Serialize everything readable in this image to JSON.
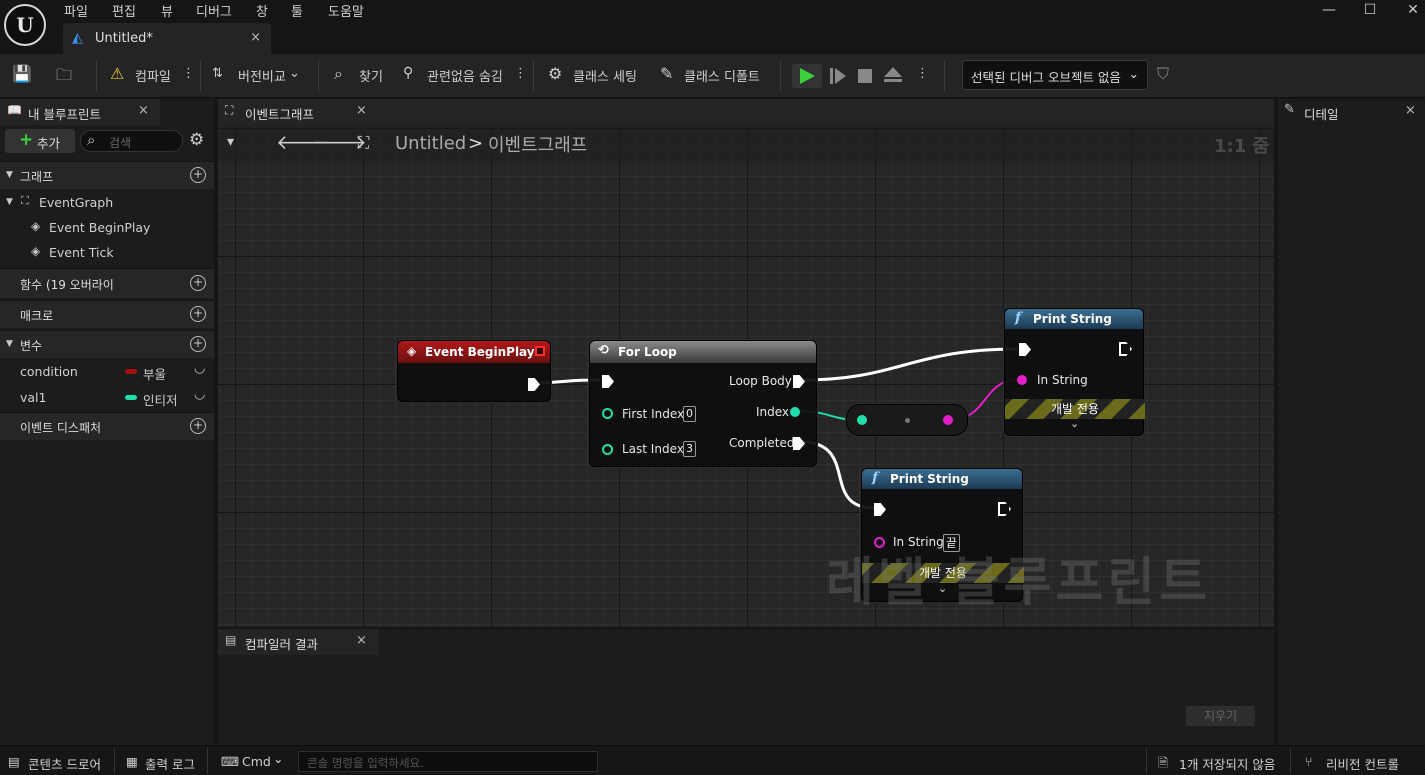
{
  "menu": [
    "파일",
    "편집",
    "뷰",
    "디버그",
    "창",
    "툴",
    "도움말"
  ],
  "doc_tab": {
    "label": "Untitled*",
    "close": "×"
  },
  "window": {
    "minimize": "—",
    "maximize": "☐",
    "close": "✕"
  },
  "toolbar": {
    "compile": "컴파일",
    "diff": "버전비교",
    "find": "찾기",
    "hide_unrelated": "관련없음 숨김",
    "class_settings": "클래스 세팅",
    "class_defaults": "클래스 디폴트",
    "debug_object": "선택된 디버그 오브젝트 없음"
  },
  "my_blueprint": {
    "tab": "내 블루프린트",
    "add": "추가",
    "search_placeholder": "검색",
    "graphs_header": "그래프",
    "event_graph": "EventGraph",
    "events": [
      "Event BeginPlay",
      "Event Tick"
    ],
    "functions_header": "함수 (19 오버라이",
    "macros_header": "매크로",
    "variables_header": "변수",
    "variables": [
      {
        "name": "condition",
        "type": "부울",
        "color": "#a40e0e"
      },
      {
        "name": "val1",
        "type": "인티저",
        "color": "#1fe0ac"
      }
    ],
    "dispatchers_header": "이벤트 디스패처"
  },
  "graph": {
    "tab": "이벤트그래프",
    "breadcrumb_root": "Untitled",
    "breadcrumb_sep": ">",
    "breadcrumb_current": "이벤트그래프",
    "zoom": "1:1 줌",
    "watermark": "레벨 블루프린트"
  },
  "nodes": {
    "begin_play": {
      "title": "Event BeginPlay"
    },
    "for_loop": {
      "title": "For Loop",
      "first_index": "First Index",
      "first_value": "0",
      "last_index": "Last Index",
      "last_value": "3",
      "loop_body": "Loop Body",
      "index": "Index",
      "completed": "Completed"
    },
    "print1": {
      "title": "Print String",
      "in_string": "In String",
      "dev": "개발 전용"
    },
    "print2": {
      "title": "Print String",
      "in_string": "In String",
      "value": "끝",
      "dev": "개발 전용"
    }
  },
  "details": {
    "tab": "디테일"
  },
  "compiler": {
    "tab": "컴파일러 결과",
    "clear": "지우기"
  },
  "statusbar": {
    "content_drawer": "콘텐츠 드로어",
    "output_log": "출력 로그",
    "cmd": "Cmd",
    "console_placeholder": "콘솔 명령을 입력하세요.",
    "unsaved": "1개 저장되지 않음",
    "revision": "리비전 컨트롤"
  }
}
